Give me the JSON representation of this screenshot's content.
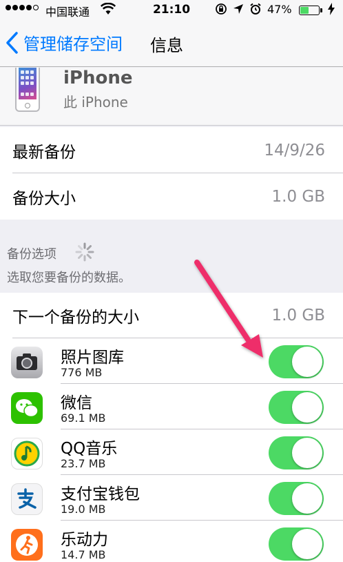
{
  "status_bar": {
    "carrier": "中国联通",
    "time": "21:10",
    "battery_percent_text": "47%",
    "battery_level": 0.47,
    "icons": [
      "signal-dots-icon",
      "wifi-icon",
      "rotation-lock-icon",
      "location-icon",
      "alarm-icon",
      "battery-icon",
      "charging-bolt-icon"
    ]
  },
  "nav": {
    "back_label": "管理储存空间",
    "title": "信息"
  },
  "device": {
    "name": "iPhone",
    "subtitle": "此 iPhone"
  },
  "info": [
    {
      "label": "最新备份",
      "value": "14/9/26"
    },
    {
      "label": "备份大小",
      "value": "1.0 GB"
    }
  ],
  "backup_options": {
    "header": "备份选项",
    "description": "选取您要备份的数据。"
  },
  "next_backup": {
    "label": "下一个备份的大小",
    "value": "1.0 GB"
  },
  "apps": [
    {
      "name": "照片图库",
      "size": "776 MB",
      "icon": "camera-icon",
      "enabled": true
    },
    {
      "name": "微信",
      "size": "69.1 MB",
      "icon": "wechat-icon",
      "enabled": true
    },
    {
      "name": "QQ音乐",
      "size": "23.7 MB",
      "icon": "qq-music-icon",
      "enabled": true
    },
    {
      "name": "支付宝钱包",
      "size": "19.0 MB",
      "icon": "alipay-icon",
      "enabled": true
    },
    {
      "name": "乐动力",
      "size": "14.7 MB",
      "icon": "ledongli-icon",
      "enabled": true
    }
  ],
  "colors": {
    "accent": "#007aff",
    "toggle_on": "#4cd964",
    "annotation_arrow": "#ee2e6b"
  }
}
